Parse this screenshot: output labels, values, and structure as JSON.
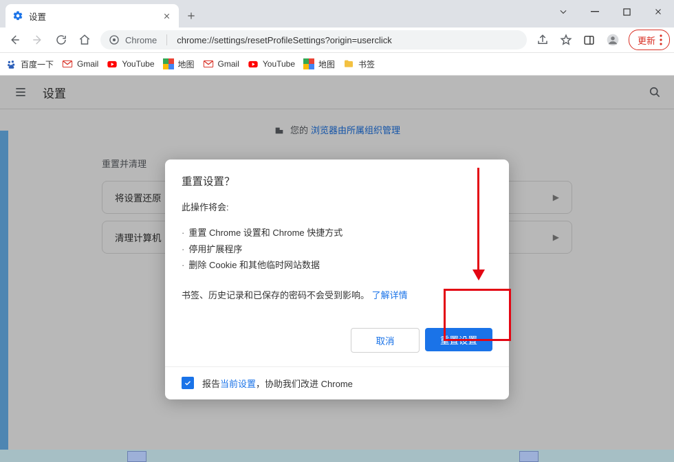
{
  "window": {
    "tab_title": "设置"
  },
  "toolbar": {
    "chrome_label": "Chrome",
    "url": "chrome://settings/resetProfileSettings?origin=userclick",
    "update_label": "更新"
  },
  "bookmarks": [
    {
      "icon": "baidu",
      "label": "百度一下"
    },
    {
      "icon": "gmail",
      "label": "Gmail"
    },
    {
      "icon": "youtube",
      "label": "YouTube"
    },
    {
      "icon": "maps",
      "label": "地图"
    },
    {
      "icon": "gmail",
      "label": "Gmail"
    },
    {
      "icon": "youtube",
      "label": "YouTube"
    },
    {
      "icon": "maps",
      "label": "地图"
    },
    {
      "icon": "folder",
      "label": "书签"
    }
  ],
  "settings": {
    "title": "设置",
    "org_prefix": "您的",
    "org_link": "浏览器由所属组织管理",
    "section": "重置并清理",
    "card1": "将设置还原",
    "card2": "清理计算机"
  },
  "dialog": {
    "title": "重置设置？",
    "intro": "此操作将会:",
    "items": [
      "重置 Chrome 设置和 Chrome 快捷方式",
      "停用扩展程序",
      "删除 Cookie 和其他临时网站数据"
    ],
    "note_pre": "书签、历史记录和已保存的密码不会受到影响。",
    "note_link": "了解详情",
    "cancel": "取消",
    "confirm": "重置设置",
    "footer_pre": "报告",
    "footer_link": "当前设置",
    "footer_post": "，协助我们改进 Chrome"
  }
}
